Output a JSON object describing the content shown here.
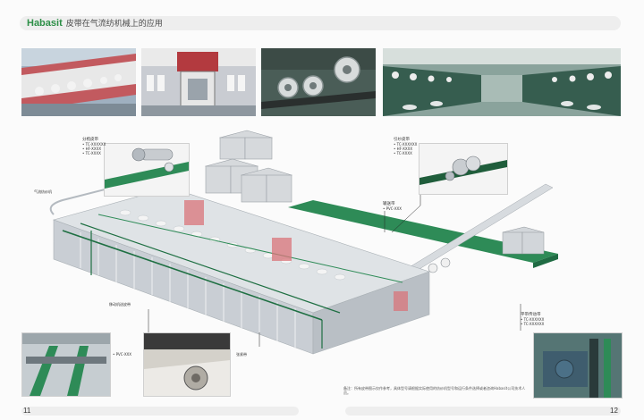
{
  "header": {
    "brand": "Habasit",
    "title": "皮带在气流纺机械上的应用"
  },
  "photos": [
    {
      "name": "photo-spinning-line"
    },
    {
      "name": "photo-machine-unit"
    },
    {
      "name": "photo-pulleys"
    },
    {
      "name": "photo-mill-hall"
    }
  ],
  "callouts": {
    "left_top": {
      "title": "分梳皮带",
      "lines": [
        "• TC-XXXXXX",
        "• HF-XXXX",
        "• TC-XXXX"
      ]
    },
    "right_top": {
      "title": "引纱皮带",
      "lines": [
        "• TC-XXXXXX",
        "• HF-XXXX",
        "• TC-XXXX"
      ]
    },
    "machine_label": "气流纺纱机",
    "conveyor": {
      "title": "输送带",
      "lines": [
        "• PVC-XXX"
      ]
    },
    "bottom_left": {
      "title": "移动机送皮带"
    },
    "bottom_left_inset": {
      "lines": [
        "• PVC-XXX"
      ]
    },
    "bottom_center": {
      "title": "张紧带"
    },
    "bottom_right": {
      "title": "平带传动带",
      "lines": [
        "• TC-XXXXXX",
        "• TC-XXXXXX"
      ]
    }
  },
  "note": "备注：所有皮带图示仅作参考，具体型号请根据实际使用的纺纱机型号和运行条件选择或者咨询Habasit公司技术人员。",
  "footer": {
    "left_page": "11",
    "right_page": "12"
  },
  "colors": {
    "brand": "#2d8f47",
    "belt": "#2e8b57",
    "machine": "#c9ced4",
    "accent": "#d9747a"
  }
}
